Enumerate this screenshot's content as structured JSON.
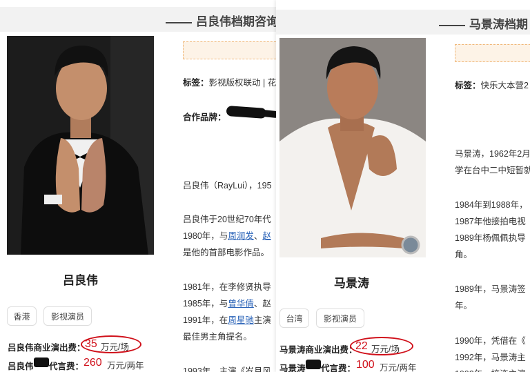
{
  "left": {
    "header_title": "吕良伟档期咨询",
    "name": "吕良伟",
    "tags": [
      "香港",
      "影视演员"
    ],
    "commercial_fee": {
      "label": "吕良伟商业演出费：",
      "value": "35",
      "unit": "万元/场"
    },
    "endorse_fee": {
      "label_start": "吕良伟",
      "label_end": "代言费：",
      "value": "260",
      "unit": "万元/两年"
    },
    "tags_line": {
      "label": "标签：",
      "value": "影视版权联动 | 花"
    },
    "brand_line": {
      "label": "合作品牌："
    },
    "paragraphs": [
      [
        "吕良伟（RayLui），195"
      ],
      [
        "吕良伟于20世纪70年代 "
      ],
      [
        "1980年，与",
        {
          "link": "周润发"
        },
        "、",
        {
          "link": "赵"
        }
      ],
      [
        "是他的首部电影作品。"
      ],
      [
        "1981年，在李修贤执导"
      ],
      [
        "1985年，与",
        {
          "link": "曾华倩"
        },
        "、赵"
      ],
      [
        "1991年，在",
        {
          "link": "周星驰"
        },
        "主演"
      ],
      [
        "最佳男主角提名。"
      ],
      [
        "1993年，主演《岁月风"
      ]
    ]
  },
  "right": {
    "header_title": "马景涛档期",
    "name": "马景涛",
    "tags": [
      "台湾",
      "影视演员"
    ],
    "commercial_fee": {
      "label": "马景涛商业演出费：",
      "value": "22",
      "unit": "万元/场"
    },
    "endorse_fee": {
      "label_start": "马景涛",
      "label_end": "代言费：",
      "value": "100",
      "unit": "万元/两年"
    },
    "tags_line": {
      "label": "标签：",
      "value": "快乐大本营2"
    },
    "paragraphs": [
      "马景涛，1962年2月",
      "学在台中二中短暂就",
      "1984年到1988年，",
      "1987年他接拍电视",
      "1989年杨佩佩执导",
      "角。",
      "1989年，马景涛签",
      "年。",
      "1990年，凭借在《",
      "1992年，马景涛主",
      "1993年，接连主演"
    ]
  },
  "colors": {
    "accent_red": "#d0101a",
    "link_blue": "#2a63b8"
  }
}
